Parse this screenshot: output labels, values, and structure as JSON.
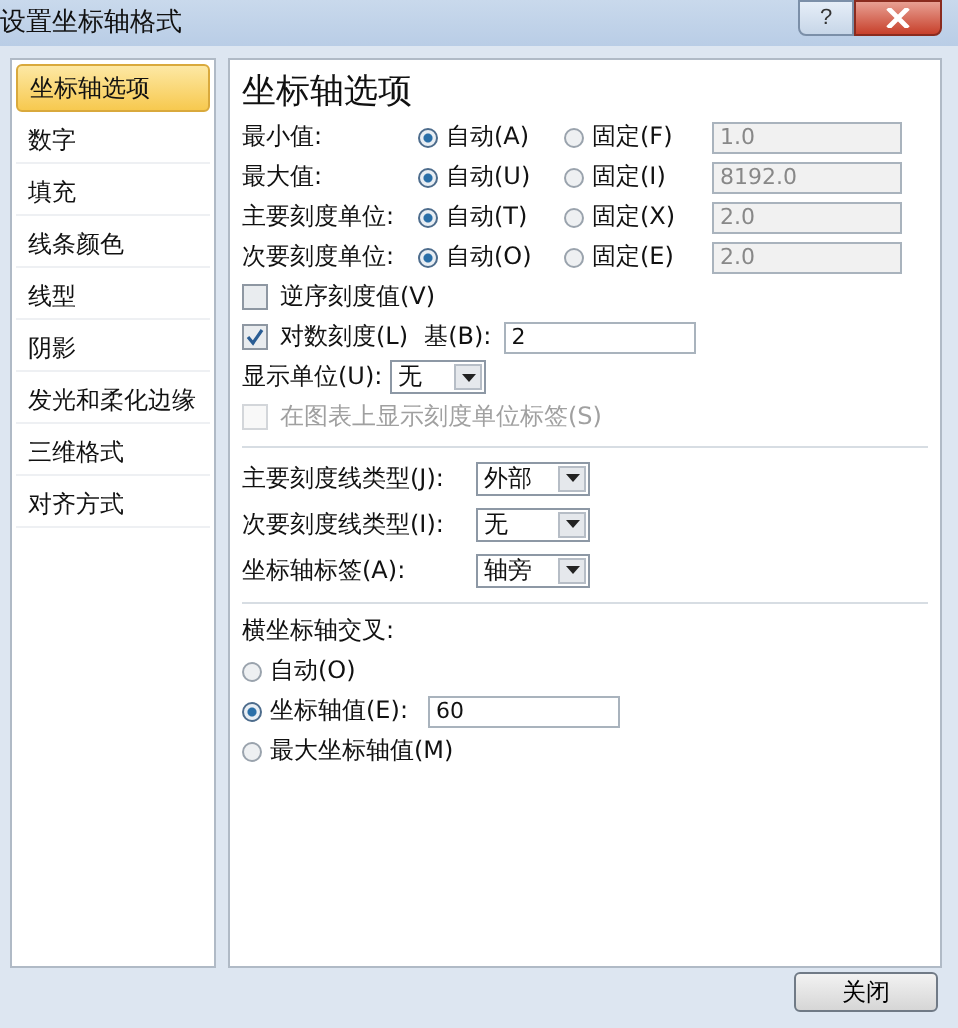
{
  "window": {
    "title": "设置坐标轴格式",
    "help": "?"
  },
  "sidebar": {
    "items": [
      {
        "label": "坐标轴选项",
        "selected": true
      },
      {
        "label": "数字",
        "selected": false
      },
      {
        "label": "填充",
        "selected": false
      },
      {
        "label": "线条颜色",
        "selected": false
      },
      {
        "label": "线型",
        "selected": false
      },
      {
        "label": "阴影",
        "selected": false
      },
      {
        "label": "发光和柔化边缘",
        "selected": false
      },
      {
        "label": "三维格式",
        "selected": false
      },
      {
        "label": "对齐方式",
        "selected": false
      }
    ]
  },
  "panel": {
    "heading": "坐标轴选项",
    "bounds": [
      {
        "label": "最小值:",
        "auto": "自动(A)",
        "fixed": "固定(F)",
        "auto_selected": true,
        "value": "1.0"
      },
      {
        "label": "最大值:",
        "auto": "自动(U)",
        "fixed": "固定(I)",
        "auto_selected": true,
        "value": "8192.0"
      },
      {
        "label": "主要刻度单位:",
        "auto": "自动(T)",
        "fixed": "固定(X)",
        "auto_selected": true,
        "value": "2.0"
      },
      {
        "label": "次要刻度单位:",
        "auto": "自动(O)",
        "fixed": "固定(E)",
        "auto_selected": true,
        "value": "2.0"
      }
    ],
    "reverse": {
      "label": "逆序刻度值(V)",
      "checked": false,
      "disabled": false
    },
    "log": {
      "label": "对数刻度(L)",
      "checked": true,
      "disabled": false,
      "base_label": "基(B):",
      "base": "2"
    },
    "display_unit": {
      "label": "显示单位(U):",
      "value": "无"
    },
    "show_unit_label": {
      "label": "在图表上显示刻度单位标签(S)",
      "checked": false,
      "disabled": true
    },
    "selects": [
      {
        "label": "主要刻度线类型(J):",
        "value": "外部"
      },
      {
        "label": "次要刻度线类型(I):",
        "value": "无"
      },
      {
        "label": "坐标轴标签(A):",
        "value": "轴旁"
      }
    ],
    "cross": {
      "heading": "横坐标轴交叉:",
      "options": [
        {
          "label": "自动(O)",
          "selected": false
        },
        {
          "label": "坐标轴值(E):",
          "selected": true,
          "value": "60"
        },
        {
          "label": "最大坐标轴值(M)",
          "selected": false
        }
      ]
    }
  },
  "buttons": [
    "关闭"
  ]
}
